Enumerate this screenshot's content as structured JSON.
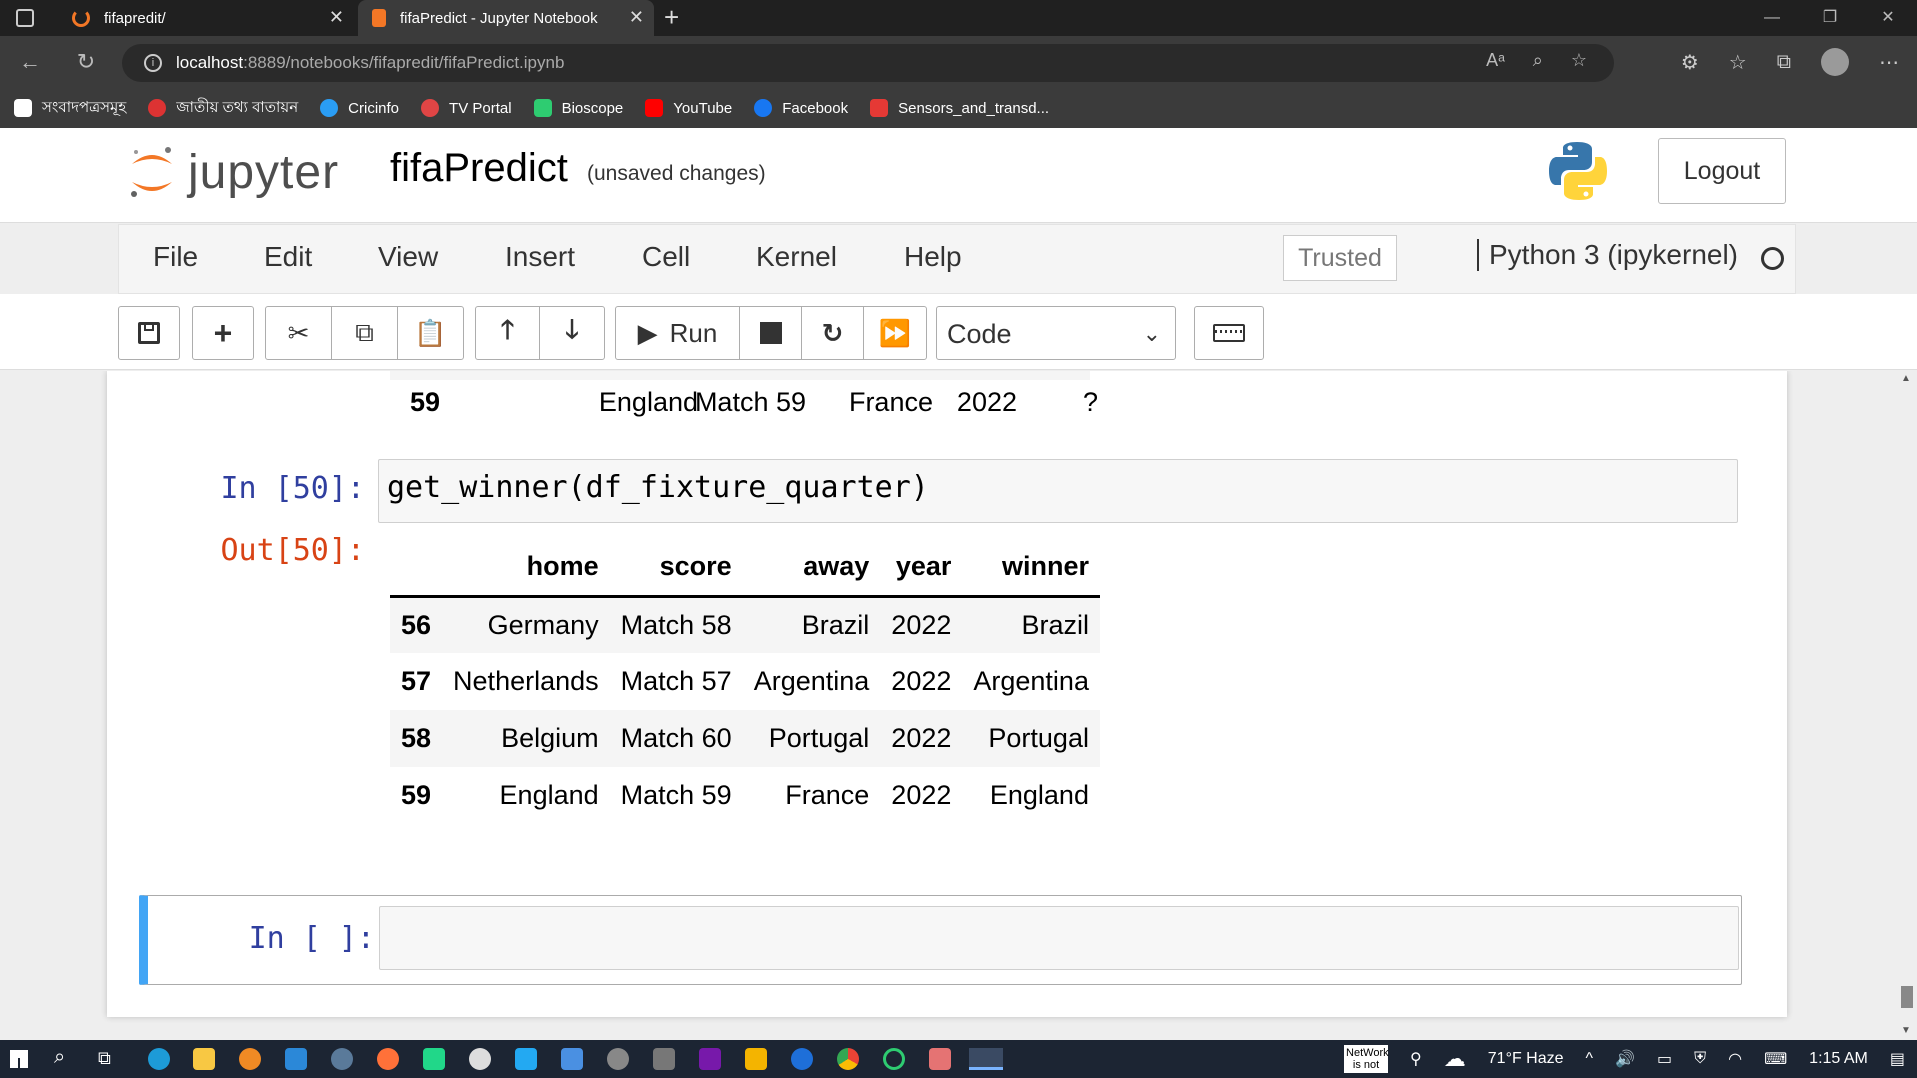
{
  "browser": {
    "tabs": [
      {
        "title": "fifapredit/",
        "active": false
      },
      {
        "title": "fifaPredict - Jupyter Notebook",
        "active": true
      }
    ],
    "url_host": "localhost",
    "url_path": ":8889/notebooks/fifapredit/fifaPredict.ipynb",
    "bookmarks": [
      {
        "label": "সংবাদপত্রসমূহ",
        "color": "#ffffff"
      },
      {
        "label": "জাতীয় তথ্য বাতায়ন",
        "color": "#d33"
      },
      {
        "label": "Cricinfo",
        "color": "#2a9df4"
      },
      {
        "label": "TV Portal",
        "color": "#e04545"
      },
      {
        "label": "Bioscope",
        "color": "#2ecc71"
      },
      {
        "label": "YouTube",
        "color": "#ff0000"
      },
      {
        "label": "Facebook",
        "color": "#1877f2"
      },
      {
        "label": "Sensors_and_transd...",
        "color": "#e53935"
      }
    ]
  },
  "jupyter": {
    "logo_text": "jupyter",
    "notebook_name": "fifaPredict",
    "save_status": "(unsaved changes)",
    "logout_label": "Logout",
    "menus": [
      "File",
      "Edit",
      "View",
      "Insert",
      "Cell",
      "Kernel",
      "Help"
    ],
    "trusted_label": "Trusted",
    "kernel_name": "Python 3 (ipykernel)",
    "toolbar": {
      "run_label": "Run",
      "cell_type": "Code"
    }
  },
  "cells": {
    "partial_row": {
      "index": "59",
      "home": "England",
      "score": "Match 59",
      "away": "France",
      "year": "2022",
      "winner": "?"
    },
    "cell50": {
      "in_prompt": "In [50]:",
      "code": "get_winner(df_fixture_quarter)",
      "out_prompt": "Out[50]:",
      "columns": [
        "home",
        "score",
        "away",
        "year",
        "winner"
      ],
      "rows": [
        {
          "index": "56",
          "home": "Germany",
          "score": "Match 58",
          "away": "Brazil",
          "year": "2022",
          "winner": "Brazil"
        },
        {
          "index": "57",
          "home": "Netherlands",
          "score": "Match 57",
          "away": "Argentina",
          "year": "2022",
          "winner": "Argentina"
        },
        {
          "index": "58",
          "home": "Belgium",
          "score": "Match 60",
          "away": "Portugal",
          "year": "2022",
          "winner": "Portugal"
        },
        {
          "index": "59",
          "home": "England",
          "score": "Match 59",
          "away": "France",
          "year": "2022",
          "winner": "England"
        }
      ]
    },
    "empty_cell": {
      "in_prompt": "In [ ]:",
      "code": ""
    }
  },
  "taskbar": {
    "network_label": "NetWork is not",
    "weather": "71°F Haze",
    "time": "1:15 AM"
  }
}
